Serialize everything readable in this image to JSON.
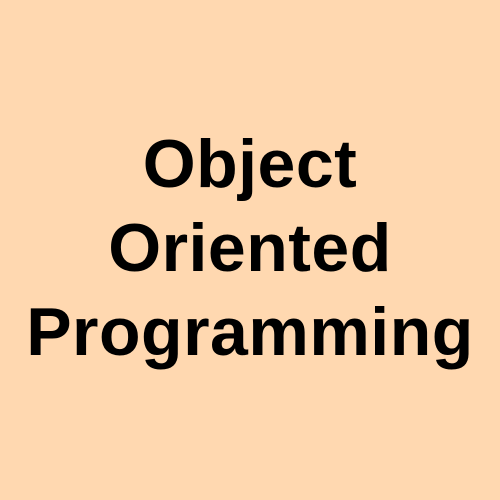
{
  "title": {
    "lines": [
      "Object",
      "Oriented",
      "Programming"
    ]
  },
  "colors": {
    "background": "#FFD8B0",
    "text": "#000000"
  }
}
